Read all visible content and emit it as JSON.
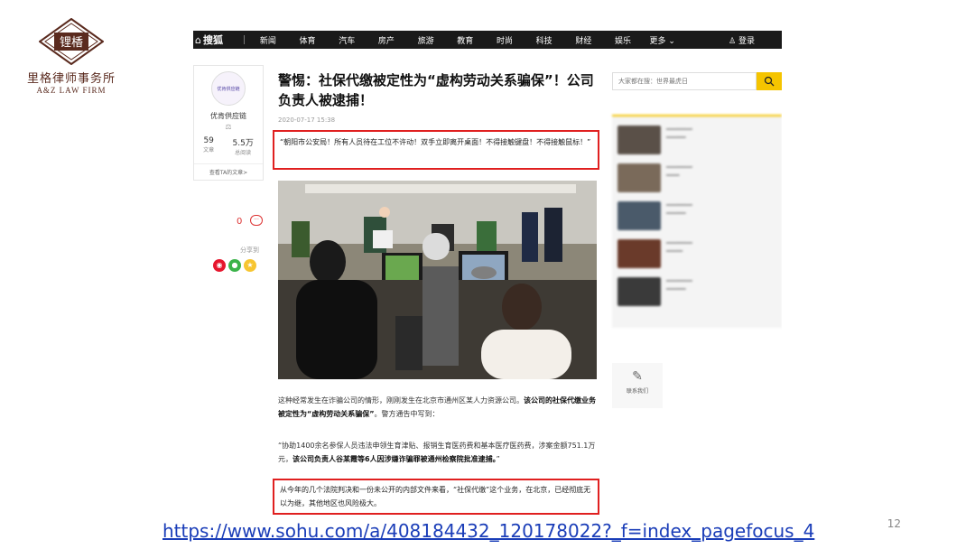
{
  "firm": {
    "logo_text": "锂楿",
    "name_cn": "里格律师事务所",
    "name_en": "A&Z LAW FIRM"
  },
  "topnav": {
    "brand": "搜狐",
    "items": [
      "新闻",
      "体育",
      "汽车",
      "房产",
      "旅游",
      "教育",
      "时尚",
      "科技",
      "财经",
      "娱乐",
      "更多"
    ],
    "login": "登录"
  },
  "author": {
    "avatar_text": "优肯供应链",
    "name": "优肯供应链",
    "articles_count": "59",
    "articles_label": "文章",
    "views_count": "5.5万",
    "views_label": "总阅读",
    "link_label": "查看TA的文章>"
  },
  "interaction": {
    "comment_count": "0",
    "share_label": "分享到"
  },
  "article": {
    "title": "警惕：社保代缴被定性为“虚构劳动关系骗保”！公司负责人被逮捕！",
    "date": "2020-07-17 15:38",
    "quote1": "“朝阳市公安局！所有人员待在工位不许动！双手立即离开桌面！不得接触键盘！不得接触鼠标！”",
    "p1_a": "这种经常发生在诈骗公司的情形，刚刚发生在北京市通州区某人力资源公司。",
    "p1_b": "该公司的社保代缴业务被定性为“虚构劳动关系骗保”",
    "p1_c": "。警方通告中写到：",
    "p2_a": "“协助1400余名参保人员违法申领生育津贴、报销生育医药费和基本医疗医药费，涉案金额751.1万元，",
    "p2_b": "该公司负责人谷某霞等6人因涉嫌诈骗罪被通州检察院批准逮捕。",
    "p2_c": "”",
    "quote2": "从今年的几个法院判决和一份未公开的内部文件来看，“社保代缴”这个业务，在北京，已经彻底无以为继，其他地区也风险极大。"
  },
  "sidebar": {
    "search_placeholder": "大家都在搜：世界最虎日",
    "contact_label": "联系我们"
  },
  "source_url": "https://www.sohu.com/a/408184432_120178022?_f=index_pagefocus_4",
  "page_number": "12",
  "colors": {
    "highlight_box": "#e02020",
    "nav_bg": "#1a1a1a",
    "search_btn": "#f5c400",
    "firm_brown": "#5a2a1e",
    "link": "#1a3db8"
  }
}
